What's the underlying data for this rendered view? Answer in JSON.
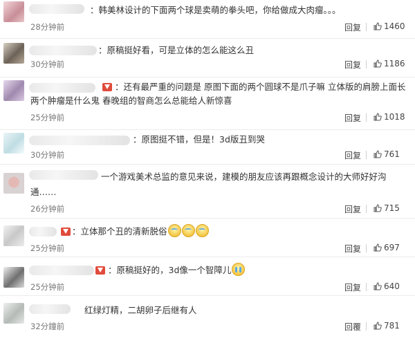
{
  "comments": [
    {
      "text": "：韩美林设计的下面两个球是卖萌的拳头吧，你给做成大肉瘤。。。",
      "time": "28分钟前",
      "reply": "回复",
      "likes": "1460"
    },
    {
      "text": "：原稿挺好看，可是立体的怎么能这么丑",
      "time": "30分钟前",
      "reply": "回复",
      "likes": "1186"
    },
    {
      "text_line1": "：还有最严重的问题是 原图下面的两个圆球不是爪子嘛 立体版的肩膀上面长",
      "text_line2": "两个肿瘤是什么鬼 春晚组的智商怎么总能给人新惊喜",
      "time": "25分钟前",
      "reply": "回复",
      "likes": "1018"
    },
    {
      "text": "：原图挺不错，但是！3d版丑到哭",
      "time": "30分钟前",
      "reply": "回复",
      "likes": "761"
    },
    {
      "text_line1": "一个游戏美术总监的意见来说，建模的朋友应该再跟概念设计的大师好好沟",
      "text_line2": "通……",
      "time": "26分钟前",
      "reply": "回复",
      "likes": "715"
    },
    {
      "text": "：立体那个丑的清新脱俗",
      "time": "25分钟前",
      "reply": "回复",
      "likes": "697"
    },
    {
      "text": "：原稿挺好的，3d像一个智障儿",
      "time": "25分钟前",
      "reply": "回复",
      "likes": "640"
    },
    {
      "text": "红绿灯精，二胡卵子后继有人",
      "time": "32分鐘前",
      "reply": "回覆",
      "likes": "781"
    }
  ],
  "icons": {
    "like": "thumbs-up-icon",
    "vip": "vip-badge-icon",
    "emoji_sweat": "sweat-face-emoji",
    "emoji_cry": "crying-face-emoji"
  },
  "colors": {
    "vip_badge": "#e14b3b",
    "text": "#333333",
    "meta": "#777777"
  }
}
